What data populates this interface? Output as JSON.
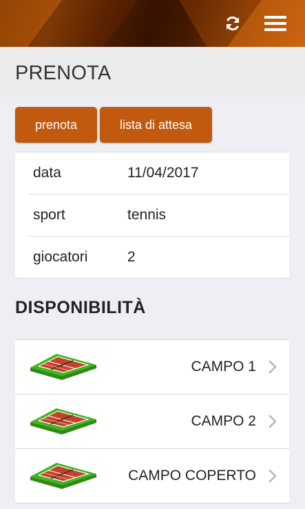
{
  "header": {
    "refresh_icon": "refresh-icon",
    "menu_icon": "hamburger-menu-icon"
  },
  "page": {
    "title": "PRENOTA"
  },
  "actions": {
    "prenota_label": "prenota",
    "waitlist_label": "lista di attesa",
    "button_color": "#c15a0e"
  },
  "details": [
    {
      "label": "data",
      "value": "11/04/2017"
    },
    {
      "label": "sport",
      "value": "tennis"
    },
    {
      "label": "giocatori",
      "value": "2"
    }
  ],
  "availability": {
    "title": "DISPONIBILITÀ",
    "courts": [
      {
        "name": "CAMPO 1",
        "icon": "tennis-court-icon"
      },
      {
        "name": "CAMPO 2",
        "icon": "tennis-court-icon"
      },
      {
        "name": "CAMPO COPERTO",
        "icon": "tennis-court-icon"
      }
    ]
  }
}
